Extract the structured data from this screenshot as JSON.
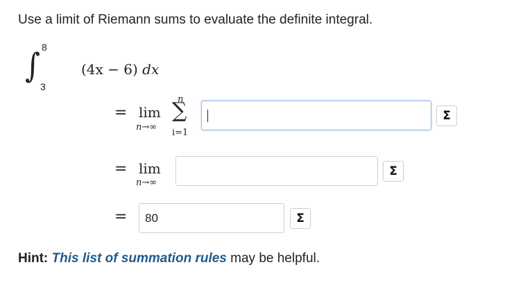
{
  "question": {
    "prompt": "Use a limit of Riemann sums to evaluate the definite integral."
  },
  "integral": {
    "upper_limit": "8",
    "lower_limit": "3",
    "integrand": "(4x − 6)",
    "differential": "dx"
  },
  "steps": {
    "equals": "=",
    "lim": "lim",
    "lim_sub": "n→∞",
    "sum_upper": "n",
    "sum_lower": "i=1",
    "answer1_value": "",
    "answer2_value": "",
    "answer3_value": "80"
  },
  "buttons": {
    "sigma_label": "Σ"
  },
  "hint": {
    "label": "Hint:",
    "link_text": "This list of summation rules",
    "suffix": " may be helpful."
  }
}
